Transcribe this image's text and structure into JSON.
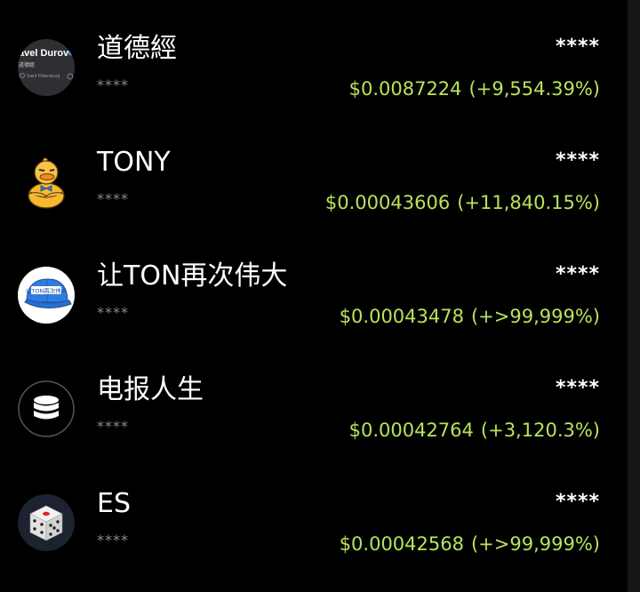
{
  "colors": {
    "background": "#000000",
    "name_text": "#ffffff",
    "masked_text": "#8c8c8c",
    "price_text": "#b8e35a"
  },
  "tokens": [
    {
      "name": "道德經",
      "balance": "****",
      "value": "****",
      "price": "$0.0087224",
      "change": "(+9,554.39%)",
      "avatar": {
        "type": "profile-screenshot",
        "profile_name": "avel Durov",
        "sub_label": "道德經",
        "location": "Saint Petersburg"
      }
    },
    {
      "name": "TONY",
      "balance": "****",
      "value": "****",
      "price": "$0.00043606",
      "change": "(+11,840.15%)",
      "avatar": {
        "type": "duck",
        "icon": "duck-mascot-icon"
      }
    },
    {
      "name": "让TON再次伟大",
      "balance": "****",
      "value": "****",
      "price": "$0.00043478",
      "change": "(+>99,999%)",
      "avatar": {
        "type": "cap",
        "cap_text": "让TON再次伟大",
        "icon": "blue-cap-icon"
      }
    },
    {
      "name": "电报人生",
      "balance": "****",
      "value": "****",
      "price": "$0.00042764",
      "change": "(+3,120.3%)",
      "avatar": {
        "type": "coin-stack",
        "icon": "coin-stack-icon"
      }
    },
    {
      "name": "ES",
      "balance": "****",
      "value": "****",
      "price": "$0.00042568",
      "change": "(+>99,999%)",
      "avatar": {
        "type": "dice",
        "icon": "dice-icon"
      }
    }
  ]
}
